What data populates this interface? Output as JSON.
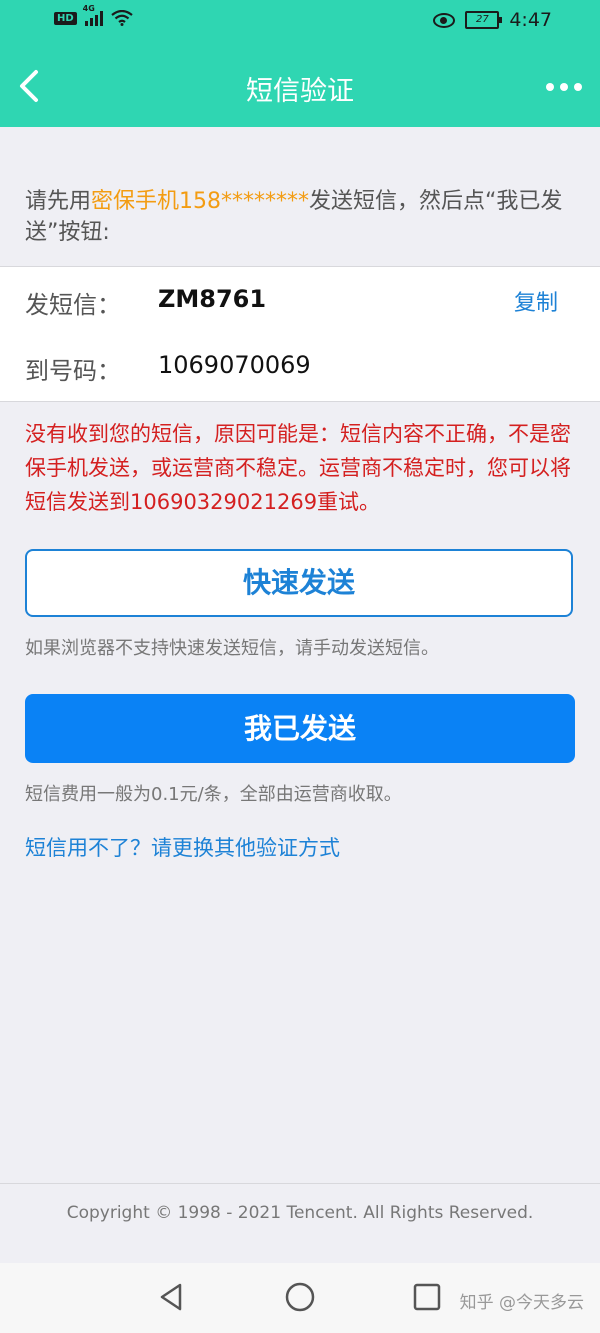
{
  "status_bar": {
    "hd": "HD",
    "network": "4G",
    "battery": "27",
    "time": "4:47"
  },
  "nav": {
    "title": "短信验证"
  },
  "instruction": {
    "prefix": "请先用",
    "highlight": "密保手机158********",
    "suffix": "发送短信，然后点“我已发送”按钮:"
  },
  "sms_card": {
    "send_label": "发短信：",
    "send_value": "ZM8761",
    "copy_label": "复制",
    "to_label": "到号码：",
    "to_value": "1069070069"
  },
  "warning": "没有收到您的短信，原因可能是：短信内容不正确，不是密保手机发送，或运营商不稳定。运营商不稳定时，您可以将短信发送到10690329021269重试。",
  "quick_send": {
    "label": "快速发送",
    "hint": "如果浏览器不支持快速发送短信，请手动发送短信。"
  },
  "sent": {
    "label": "我已发送",
    "hint": "短信费用一般为0.1元/条，全部由运营商收取。"
  },
  "alt_method_link": "短信用不了？请更换其他验证方式",
  "footer": {
    "copyright": "Copyright © 1998 - 2021 Tencent. All Rights Reserved."
  },
  "watermark": "知乎 @今天多云",
  "colors": {
    "header": "#2fd6b2",
    "primary": "#0a82f5",
    "link": "#1d82d6",
    "warning": "#d42020",
    "highlight": "#f39c12"
  },
  "icons": [
    "back-arrow-icon",
    "more-icon",
    "eye-icon",
    "wifi-icon",
    "nav-back-icon",
    "nav-home-icon",
    "nav-recents-icon"
  ]
}
